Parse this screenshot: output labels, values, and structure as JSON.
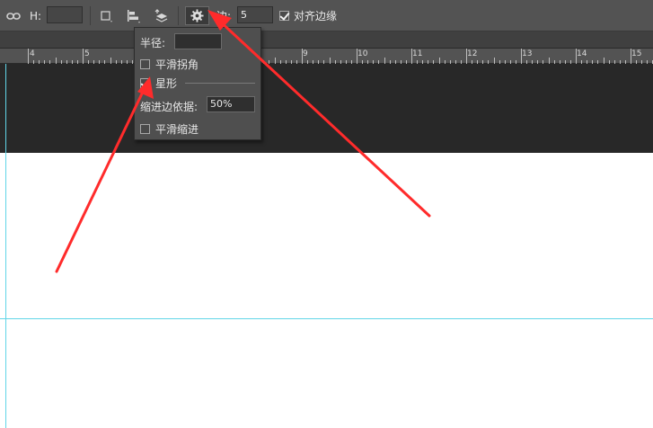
{
  "options_bar": {
    "h_label": "H:",
    "h_value": "",
    "sides_label": "边:",
    "sides_value": "5",
    "align_edges_label": "对齐边缘",
    "align_edges_checked": true
  },
  "ruler": {
    "ticks": [
      "4",
      "5",
      "9",
      "10",
      "11",
      "12",
      "13",
      "14",
      "15"
    ]
  },
  "shape_options_popup": {
    "radius_label": "半径:",
    "radius_value": "",
    "smooth_corners_label": "平滑拐角",
    "smooth_corners_checked": false,
    "star_label": "星形",
    "star_checked": true,
    "indent_label": "缩进边依据:",
    "indent_value": "50%",
    "smooth_indents_label": "平滑缩进",
    "smooth_indents_checked": false
  },
  "colors": {
    "toolbar_bg": "#535353",
    "pasteboard": "#282828",
    "guide": "#61d6e8",
    "annotation_arrow": "#ff2b2b"
  }
}
